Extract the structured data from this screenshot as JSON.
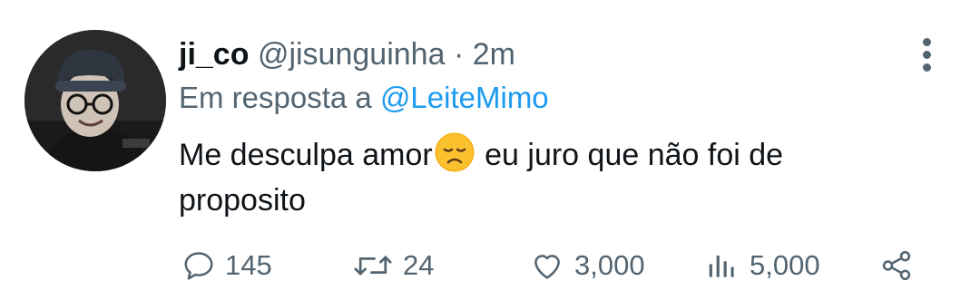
{
  "user": {
    "display_name": "ji_co",
    "handle": "@jisunguinha",
    "separator": "·",
    "time": "2m"
  },
  "reply": {
    "prefix": "Em resposta a",
    "mention": "@LeiteMimo"
  },
  "tweet": {
    "text_before_emoji": "Me desculpa amor",
    "emoji": "disappointed-face",
    "text_after_emoji": " eu juro que não foi de proposito"
  },
  "actions": {
    "replies": "145",
    "retweets": "24",
    "likes": "3,000",
    "views": "5,000"
  },
  "colors": {
    "text": "#0f1419",
    "muted": "#536471",
    "link": "#1d9bf0"
  }
}
